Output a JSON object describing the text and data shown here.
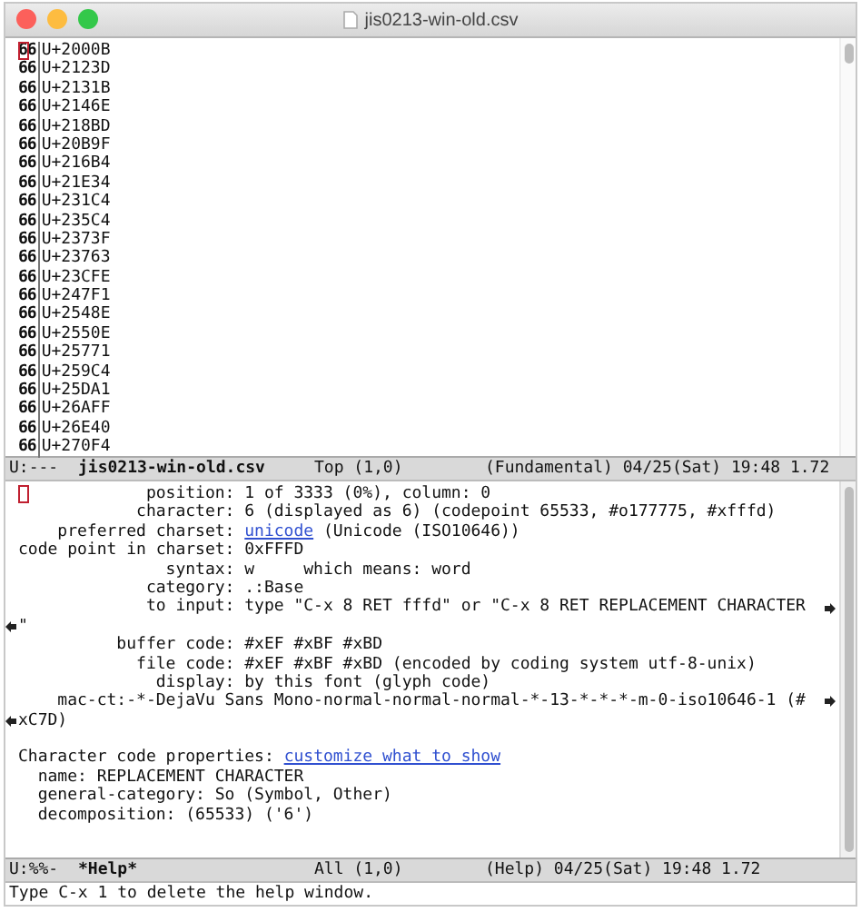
{
  "window": {
    "title": "jis0213-win-old.csv"
  },
  "buffer": {
    "rows": [
      {
        "glyph": "66",
        "code": "U+2000B",
        "cursor": true
      },
      {
        "glyph": "66",
        "code": "U+2123D",
        "cursor": false
      },
      {
        "glyph": "66",
        "code": "U+2131B",
        "cursor": false
      },
      {
        "glyph": "66",
        "code": "U+2146E",
        "cursor": false
      },
      {
        "glyph": "66",
        "code": "U+218BD",
        "cursor": false
      },
      {
        "glyph": "66",
        "code": "U+20B9F",
        "cursor": false
      },
      {
        "glyph": "66",
        "code": "U+216B4",
        "cursor": false
      },
      {
        "glyph": "66",
        "code": "U+21E34",
        "cursor": false
      },
      {
        "glyph": "66",
        "code": "U+231C4",
        "cursor": false
      },
      {
        "glyph": "66",
        "code": "U+235C4",
        "cursor": false
      },
      {
        "glyph": "66",
        "code": "U+2373F",
        "cursor": false
      },
      {
        "glyph": "66",
        "code": "U+23763",
        "cursor": false
      },
      {
        "glyph": "66",
        "code": "U+23CFE",
        "cursor": false
      },
      {
        "glyph": "66",
        "code": "U+247F1",
        "cursor": false
      },
      {
        "glyph": "66",
        "code": "U+2548E",
        "cursor": false
      },
      {
        "glyph": "66",
        "code": "U+2550E",
        "cursor": false
      },
      {
        "glyph": "66",
        "code": "U+25771",
        "cursor": false
      },
      {
        "glyph": "66",
        "code": "U+259C4",
        "cursor": false
      },
      {
        "glyph": "66",
        "code": "U+25DA1",
        "cursor": false
      },
      {
        "glyph": "66",
        "code": "U+26AFF",
        "cursor": false
      },
      {
        "glyph": "66",
        "code": "U+26E40",
        "cursor": false
      },
      {
        "glyph": "66",
        "code": "U+270F4",
        "cursor": false
      }
    ]
  },
  "mode_line_1": {
    "status": "U:---",
    "buffer_name": "jis0213-win-old.csv",
    "position": "Top (1,0)",
    "info": "(Fundamental) 04/25(Sat) 19:48 1.72"
  },
  "help": {
    "lines": [
      {
        "kind": "plain",
        "cursor": true,
        "parts": [
          {
            "text": "             position: 1 of 3333 (0%), column: 0",
            "link": false
          }
        ]
      },
      {
        "kind": "plain",
        "cursor": false,
        "parts": [
          {
            "text": "            character: 6 (displayed as 6) (codepoint 65533, #o177775, #xfffd)",
            "link": false
          }
        ]
      },
      {
        "kind": "plain",
        "cursor": false,
        "parts": [
          {
            "text": "    preferred charset: ",
            "link": false
          },
          {
            "text": "unicode",
            "link": true
          },
          {
            "text": " (Unicode (ISO10646))",
            "link": false
          }
        ]
      },
      {
        "kind": "plain",
        "cursor": false,
        "parts": [
          {
            "text": "code point in charset: 0xFFFD",
            "link": false
          }
        ]
      },
      {
        "kind": "plain",
        "cursor": false,
        "parts": [
          {
            "text": "               syntax: w     which means: word",
            "link": false
          }
        ]
      },
      {
        "kind": "plain",
        "cursor": false,
        "parts": [
          {
            "text": "             category: .:Base",
            "link": false
          }
        ]
      },
      {
        "kind": "wrapped",
        "cursor": false,
        "parts": [
          {
            "text": "             to input: type \"C-x 8 RET fffd\" or \"C-x 8 RET REPLACEMENT CHARACTER",
            "link": false
          }
        ]
      },
      {
        "kind": "tail",
        "cursor": false,
        "parts": [
          {
            "text": "\"",
            "link": false
          }
        ]
      },
      {
        "kind": "plain",
        "cursor": false,
        "parts": [
          {
            "text": "          buffer code: #xEF #xBF #xBD",
            "link": false
          }
        ]
      },
      {
        "kind": "plain",
        "cursor": false,
        "parts": [
          {
            "text": "            file code: #xEF #xBF #xBD (encoded by coding system utf-8-unix)",
            "link": false
          }
        ]
      },
      {
        "kind": "plain",
        "cursor": false,
        "parts": [
          {
            "text": "              display: by this font (glyph code)",
            "link": false
          }
        ]
      },
      {
        "kind": "wrapped",
        "cursor": false,
        "parts": [
          {
            "text": "    mac-ct:-*-DejaVu Sans Mono-normal-normal-normal-*-13-*-*-*-m-0-iso10646-1 (#",
            "link": false
          }
        ]
      },
      {
        "kind": "tail",
        "cursor": false,
        "parts": [
          {
            "text": "xC7D)",
            "link": false
          }
        ]
      },
      {
        "kind": "blank",
        "cursor": false
      },
      {
        "kind": "plain",
        "cursor": false,
        "parts": [
          {
            "text": "Character code properties: ",
            "link": false
          },
          {
            "text": "customize what to show",
            "link": true
          }
        ]
      },
      {
        "kind": "plain",
        "cursor": false,
        "parts": [
          {
            "text": "  name: REPLACEMENT CHARACTER",
            "link": false
          }
        ]
      },
      {
        "kind": "plain",
        "cursor": false,
        "parts": [
          {
            "text": "  general-category: So (Symbol, Other)",
            "link": false
          }
        ]
      },
      {
        "kind": "plain",
        "cursor": false,
        "parts": [
          {
            "text": "  decomposition: (65533) ('6')",
            "link": false
          }
        ]
      }
    ]
  },
  "mode_line_2": {
    "status": "U:%%-",
    "buffer_name": "*Help*",
    "position": "All (1,0)",
    "info": "(Help) 04/25(Sat) 19:48 1.72"
  },
  "echo_area": "Type C-x 1 to delete the help window."
}
